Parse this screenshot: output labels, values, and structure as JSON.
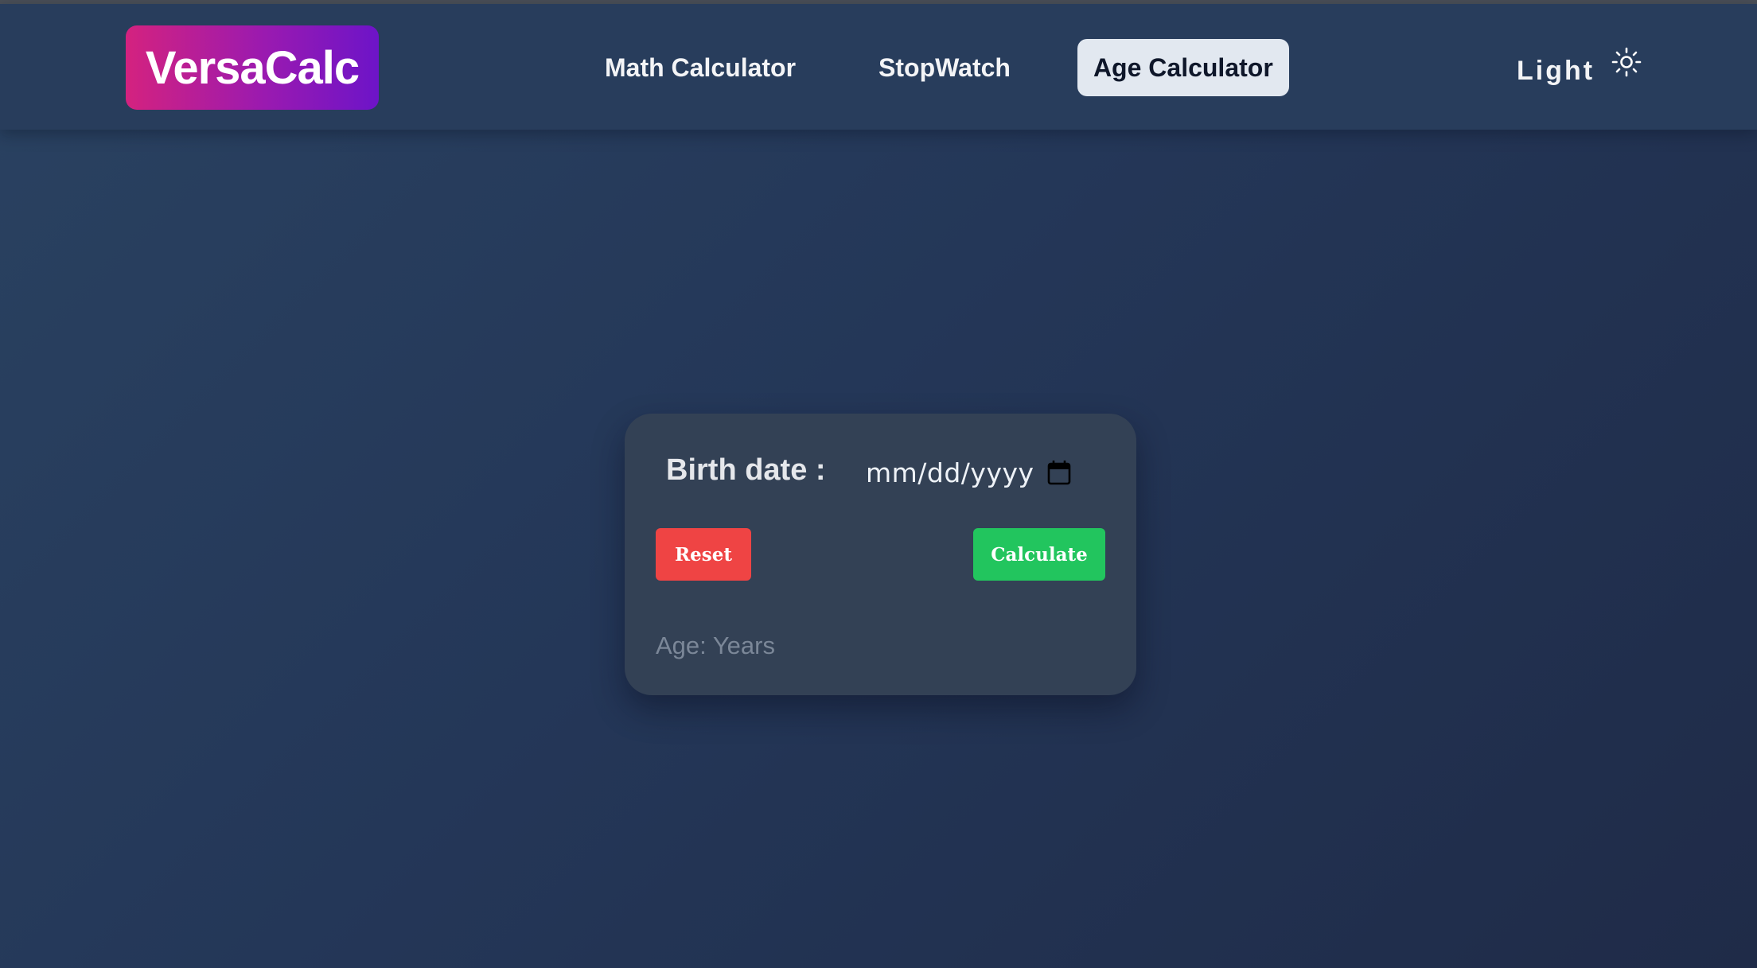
{
  "app": {
    "logo_text": "VersaCalc"
  },
  "nav": {
    "items": [
      {
        "label": "Math Calculator",
        "active": false
      },
      {
        "label": "StopWatch",
        "active": false
      },
      {
        "label": "Age Calculator",
        "active": true
      }
    ]
  },
  "theme": {
    "label": "Light",
    "icon": "sun-icon"
  },
  "age_form": {
    "birth_label": "Birth date :",
    "date_placeholder": "mm/dd/yyyy",
    "calendar_icon": "calendar-icon",
    "reset_label": "Reset",
    "calculate_label": "Calculate",
    "result_text": "Age: Years"
  },
  "colors": {
    "logo_gradient_start": "#d4227f",
    "logo_gradient_end": "#6d14c8",
    "reset_button": "#ef4444",
    "calculate_button": "#22c55e",
    "card_background": "#334155",
    "active_tab_background": "#e2e8f0"
  }
}
